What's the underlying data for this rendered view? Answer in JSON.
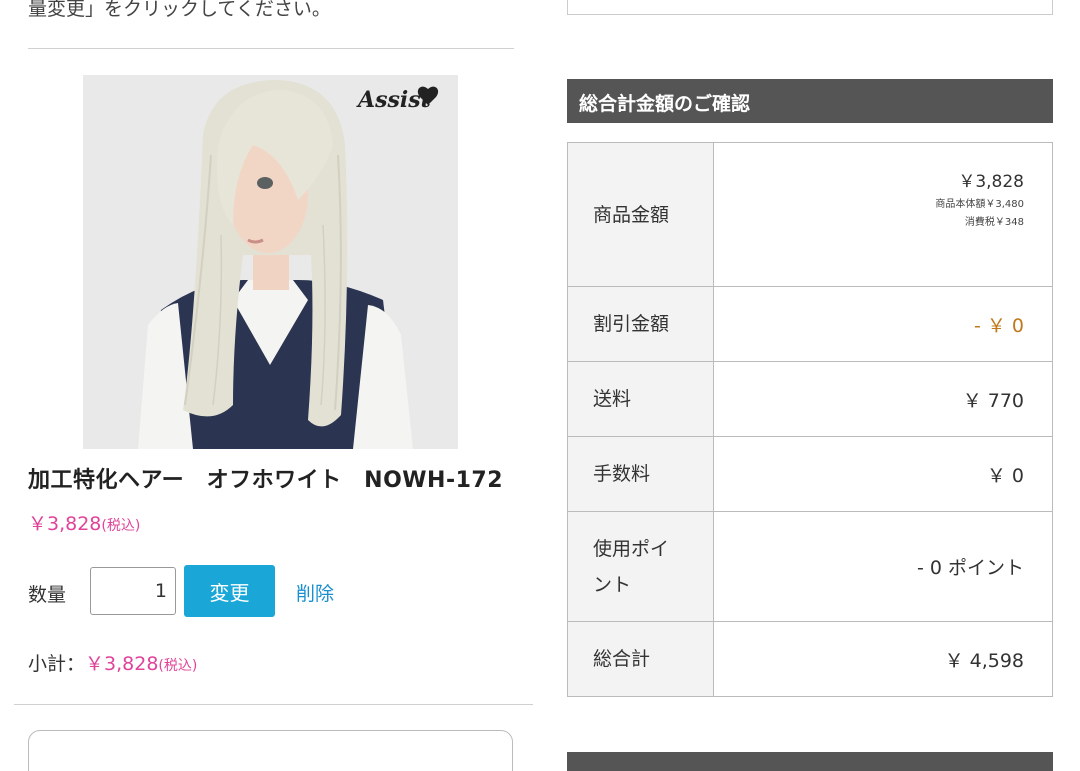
{
  "cart_item": {
    "top_note": "量変更」をクリックしてください。",
    "name": "加工特化ヘアー　オフホワイト　NOWH-172",
    "price": "￥3,828",
    "tax_note": "(税込)",
    "brand_logo": "Assist",
    "quantity_label": "数量",
    "quantity_value": "1",
    "change_label": "変更",
    "delete_label": "削除",
    "subtotal_label": "小計：",
    "subtotal_value": "￥3,828",
    "subtotal_tax_note": "(税込)"
  },
  "summary": {
    "header": "総合計金額のご確認",
    "rows": [
      {
        "label": "商品金額",
        "value": "￥3,828",
        "details": [
          "商品本体額￥3,480",
          "消費税￥348"
        ]
      },
      {
        "label": "割引金額",
        "value": "- ￥ 0"
      },
      {
        "label": "送料",
        "value": "￥ 770"
      },
      {
        "label": "手数料",
        "value": "￥ 0"
      },
      {
        "label_lines": [
          "使用ポイ",
          "ント"
        ],
        "value": "- 0 ポイント"
      },
      {
        "label": "総合計",
        "value": "￥ 4,598"
      }
    ]
  },
  "colors": {
    "price_pink": "#e0439a",
    "button_blue": "#1aa7d8",
    "link_blue": "#1a8fcf",
    "header_gray": "#555555",
    "discount_orange": "#c07a1e"
  }
}
